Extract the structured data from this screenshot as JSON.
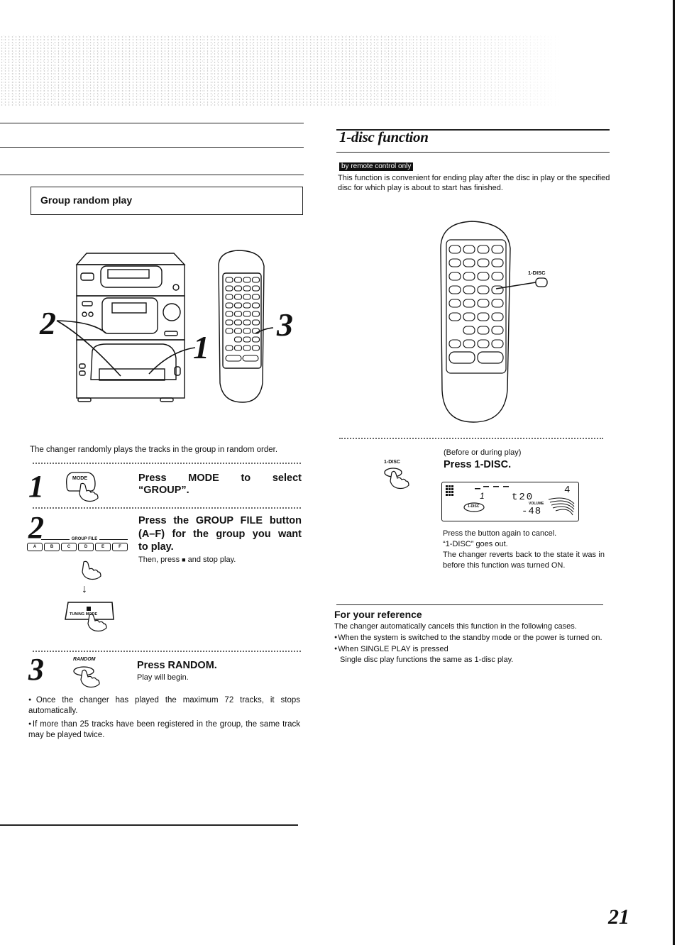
{
  "page": {
    "number": "21"
  },
  "left": {
    "section_title": "Group random play",
    "figure_callouts": [
      "2",
      "1",
      "3"
    ],
    "intro": "The changer randomly plays the tracks in the group in random order.",
    "steps": [
      {
        "number": "1",
        "button_label": "MODE",
        "title_words": [
          "Press",
          "MODE",
          "to",
          "select"
        ],
        "title_line2": "“GROUP”."
      },
      {
        "number": "2",
        "title_line1": "Press the GROUP FILE button",
        "title_line2": "(A–F) for the group you want",
        "title_line3": "to play.",
        "note_before": "Then, press ",
        "note_after": " and stop play.",
        "stop_symbol": "■",
        "group_file_label": "GROUP FILE",
        "group_buttons": [
          "A",
          "B",
          "C",
          "D",
          "E",
          "F"
        ],
        "stop_button_label": "TUNING MODE"
      },
      {
        "number": "3",
        "button_label": "RANDOM",
        "title": "Press RANDOM.",
        "note": "Play will begin."
      }
    ],
    "notes": [
      "Once the changer has played the maximum 72 tracks, it stops automatically.",
      "If more than 25 tracks have been registered in the group, the same track may be played twice."
    ]
  },
  "right": {
    "section_title": "1-disc function",
    "tag": "by remote control only",
    "intro": "This function is convenient for ending play after the disc in play or the specified disc for which play is about to start has finished.",
    "remote_callout": "1-DISC",
    "step": {
      "button_label": "1-DISC",
      "condition": "(Before or during play)",
      "title": "Press 1-DISC.",
      "display": {
        "track": "1",
        "time": "t20",
        "volume_label": "VOLUME",
        "volume": "-48",
        "disc": "4",
        "indicator": "1-DISC"
      },
      "notes": [
        "Press the button again to cancel.",
        "“1-DISC” goes out.",
        "The changer reverts back to the state it was in before this function was turned ON."
      ]
    },
    "reference": {
      "title": "For your reference",
      "intro": "The changer automatically cancels this function in the following cases.",
      "bullets": [
        "When the system is switched to the standby mode or the power is turned on.",
        "When SINGLE PLAY is pressed"
      ],
      "footer": "Single disc play functions the same as 1-disc play."
    }
  }
}
